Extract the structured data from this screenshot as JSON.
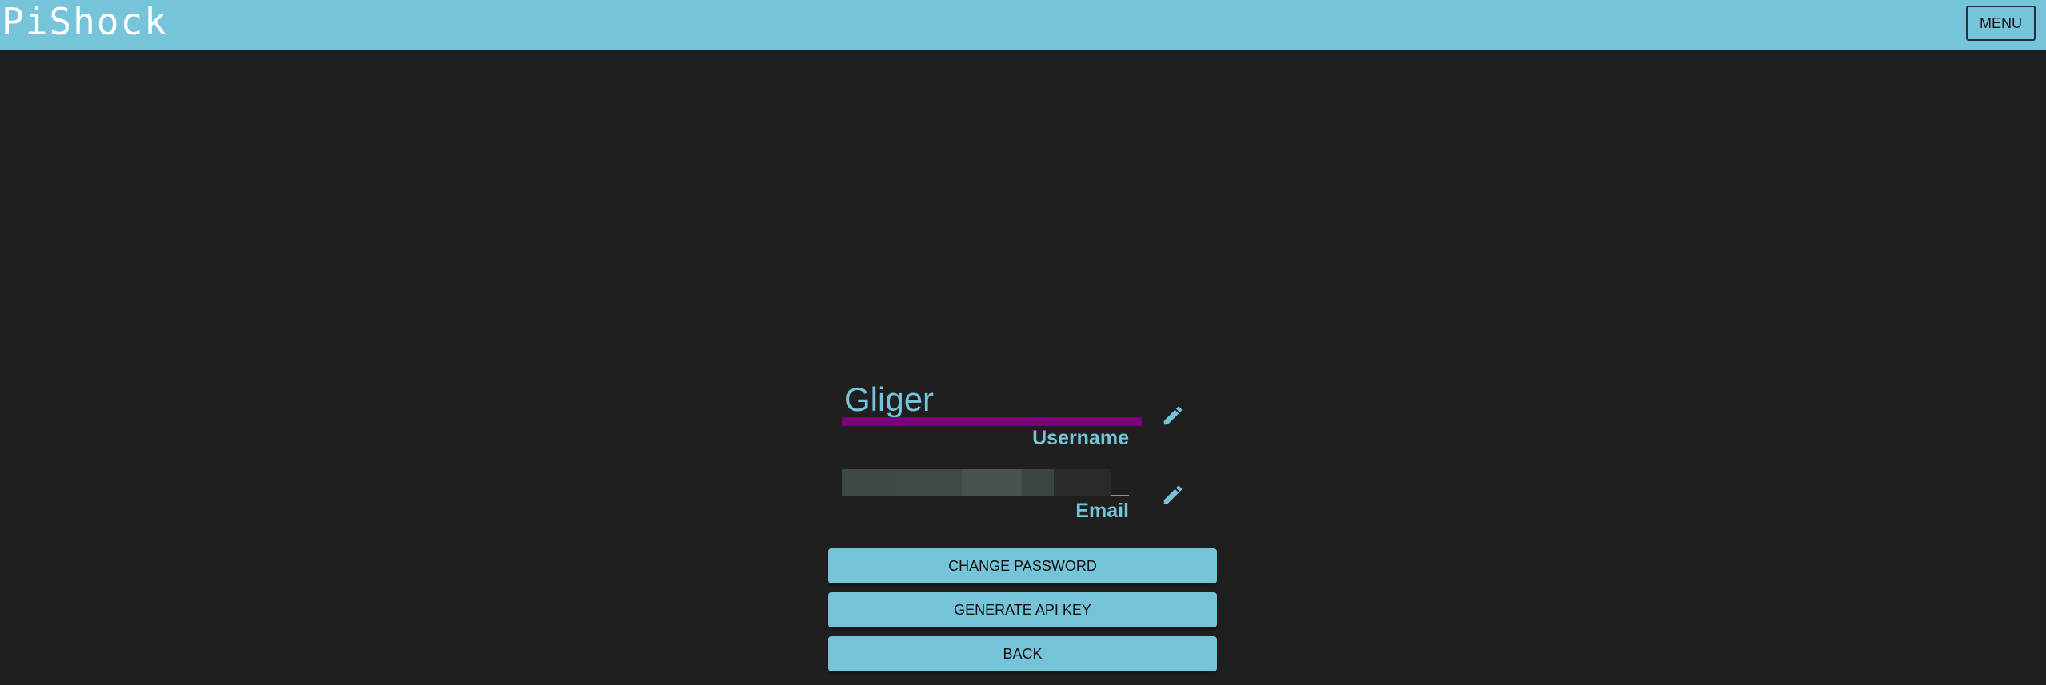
{
  "header": {
    "logo_text": "PiShock",
    "menu_label": "MENU",
    "background_color": "#76c4d9"
  },
  "account": {
    "username_value": "Gliger",
    "username_label": "Username",
    "email_label": "Email",
    "accent_color": "#7c007c",
    "edit_icon": "pencil-icon"
  },
  "actions": {
    "change_password_label": "CHANGE PASSWORD",
    "generate_api_key_label": "GENERATE API KEY",
    "back_label": "BACK"
  }
}
